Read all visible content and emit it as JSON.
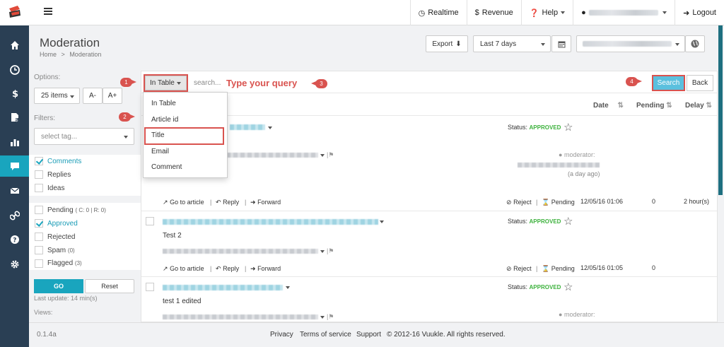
{
  "topbar": {
    "realtime_label": "Realtime",
    "revenue_label": "Revenue",
    "help_label": "Help",
    "logout_label": "Logout"
  },
  "header": {
    "title": "Moderation",
    "breadcrumb_home": "Home",
    "breadcrumb_sep": ">",
    "breadcrumb_current": "Moderation",
    "export_label": "Export",
    "date_range": "Last 7 days"
  },
  "options": {
    "label": "Options:",
    "items_per_page": "25 items",
    "font_decrease": "A-",
    "font_increase": "A+"
  },
  "filters": {
    "label": "Filters:",
    "tag_placeholder": "select tag...",
    "type_items": [
      {
        "label": "Comments",
        "checked": true
      },
      {
        "label": "Replies",
        "checked": false
      },
      {
        "label": "Ideas",
        "checked": false
      }
    ],
    "status_items": [
      {
        "label": "Pending",
        "note": "( C: 0 | R: 0)",
        "checked": false
      },
      {
        "label": "Approved",
        "note": "",
        "checked": true
      },
      {
        "label": "Rejected",
        "note": "",
        "checked": false
      },
      {
        "label": "Spam",
        "note": "(0)",
        "checked": false
      },
      {
        "label": "Flagged",
        "note": "(3)",
        "checked": false
      }
    ],
    "go_label": "GO",
    "reset_label": "Reset",
    "last_update": "Last update: 14 min(s)",
    "views_label": "Views:"
  },
  "search": {
    "scope_label": "In Table",
    "placeholder": "search...",
    "hint": "Type your query",
    "search_label": "Search",
    "back_label": "Back"
  },
  "scope_menu": [
    "In Table",
    "Article id",
    "Title",
    "Email",
    "Comment"
  ],
  "table": {
    "col_date": "Date",
    "col_pending": "Pending",
    "col_delay": "Delay"
  },
  "rows": [
    {
      "text": "",
      "status_label": "Status:",
      "status": "APPROVED",
      "moderator_label": "moderator:",
      "moderated_when": "(a day ago)",
      "date": "12/05/16 01:06",
      "pending": "0",
      "delay": "2 hour(s)"
    },
    {
      "text": "Test 2",
      "status_label": "Status:",
      "status": "APPROVED",
      "date": "12/05/16 01:05",
      "pending": "0",
      "delay": ""
    },
    {
      "text": "test 1 edited",
      "status_label": "Status:",
      "status": "APPROVED",
      "moderator_label": "moderator:"
    }
  ],
  "actions": {
    "go_to_article": "Go to article",
    "reply": "Reply",
    "forward": "Forward",
    "reject": "Reject",
    "pending": "Pending",
    "sep": "|"
  },
  "callouts": [
    "1",
    "2",
    "3",
    "4"
  ],
  "footer": {
    "version": "0.1.4a",
    "privacy": "Privacy",
    "terms": "Terms of service",
    "support": "Support",
    "copyright": "© 2012-16 Vuukle. All rights reserved."
  },
  "colors": {
    "sidebar_bg": "#2a3f54",
    "accent": "#19a5be",
    "approved": "#3db23d",
    "callout": "#d9534f"
  }
}
